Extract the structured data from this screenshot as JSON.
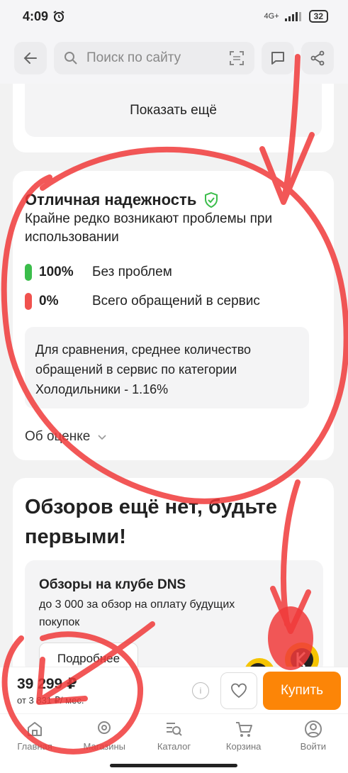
{
  "status": {
    "time": "4:09",
    "network": "4G+",
    "battery": "32"
  },
  "search": {
    "placeholder": "Поиск по сайту"
  },
  "show_more": "Показать ещё",
  "reliability": {
    "title": "Отличная надежность",
    "subtitle": "Крайне редко возникают проблемы при использовании",
    "metrics": [
      {
        "value": "100%",
        "label": "Без проблем",
        "color": "#3bbd4b"
      },
      {
        "value": "0%",
        "label": "Всего обращений в сервис",
        "color": "#f0524e"
      }
    ],
    "comparison": "Для сравнения, среднее количество обращений в сервис по категории Холодильники - 1.16%",
    "about": "Об оценке"
  },
  "reviews": {
    "title": "Обзоров ещё нет, будьте первыми!",
    "club_title": "Обзоры на клубе DNS",
    "club_sub": "до 3 000 за обзор на оплату будущих покупок",
    "more": "Подробнее"
  },
  "buy": {
    "price": "39 299 ₽",
    "monthly": "от 3 831 ₽/ мес.",
    "button": "Купить",
    "accent": "#fc8507"
  },
  "tabs": [
    {
      "label": "Главная",
      "icon": "home-icon"
    },
    {
      "label": "Магазины",
      "icon": "location-icon"
    },
    {
      "label": "Каталог",
      "icon": "catalog-icon"
    },
    {
      "label": "Корзина",
      "icon": "cart-icon"
    },
    {
      "label": "Войти",
      "icon": "user-icon"
    }
  ]
}
